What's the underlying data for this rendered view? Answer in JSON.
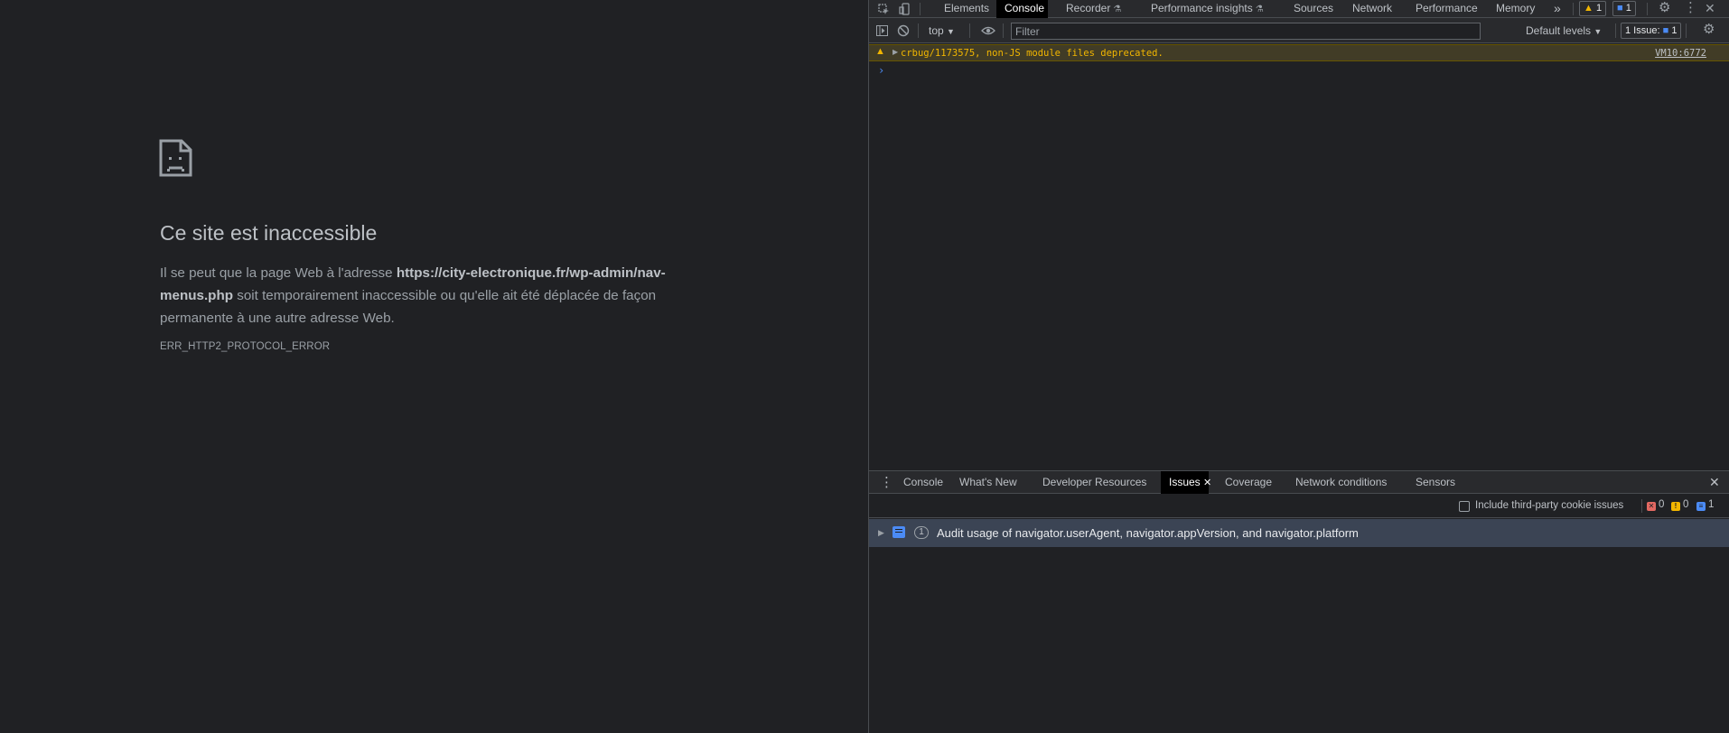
{
  "page": {
    "title": "Ce site est inaccessible",
    "body_before": "Il se peut que la page Web à l'adresse ",
    "url": "https://city-electronique.fr/wp-admin/nav-menus.php",
    "body_after": " soit temporairement inaccessible ou qu'elle ait été déplacée de façon permanente à une autre adresse Web.",
    "error_code": "ERR_HTTP2_PROTOCOL_ERROR"
  },
  "devtools": {
    "main_tabs": [
      {
        "label": "Elements"
      },
      {
        "label": "Console"
      },
      {
        "label": "Recorder"
      },
      {
        "label": "Performance insights"
      },
      {
        "label": "Sources"
      },
      {
        "label": "Network"
      },
      {
        "label": "Performance"
      },
      {
        "label": "Memory"
      }
    ],
    "more_tabs": "»",
    "warning_count": "1",
    "message_count": "1",
    "console_toolbar": {
      "context": "top",
      "filter_placeholder": "Filter",
      "levels": "Default levels",
      "issues_label": "1 Issue:",
      "issues_count": "1"
    },
    "console_messages": [
      {
        "level": "warning",
        "text": "crbug/1173575, non-JS module files deprecated.",
        "source": "VM10:6772"
      }
    ],
    "prompt": "›",
    "drawer_tabs": [
      {
        "label": "Console"
      },
      {
        "label": "What's New"
      },
      {
        "label": "Developer Resources"
      },
      {
        "label": "Issues"
      },
      {
        "label": "Coverage"
      },
      {
        "label": "Network conditions"
      },
      {
        "label": "Sensors"
      }
    ],
    "issues": {
      "include_third_party": "Include third-party cookie issues",
      "errors": "0",
      "warnings": "0",
      "infos": "1",
      "items": [
        {
          "count": "1",
          "title": "Audit usage of navigator.userAgent, navigator.appVersion, and navigator.platform"
        }
      ]
    }
  },
  "colors": {
    "background": "#202124",
    "warning": "#f2b600",
    "accent": "#4b8bf5",
    "error": "#e46962"
  }
}
